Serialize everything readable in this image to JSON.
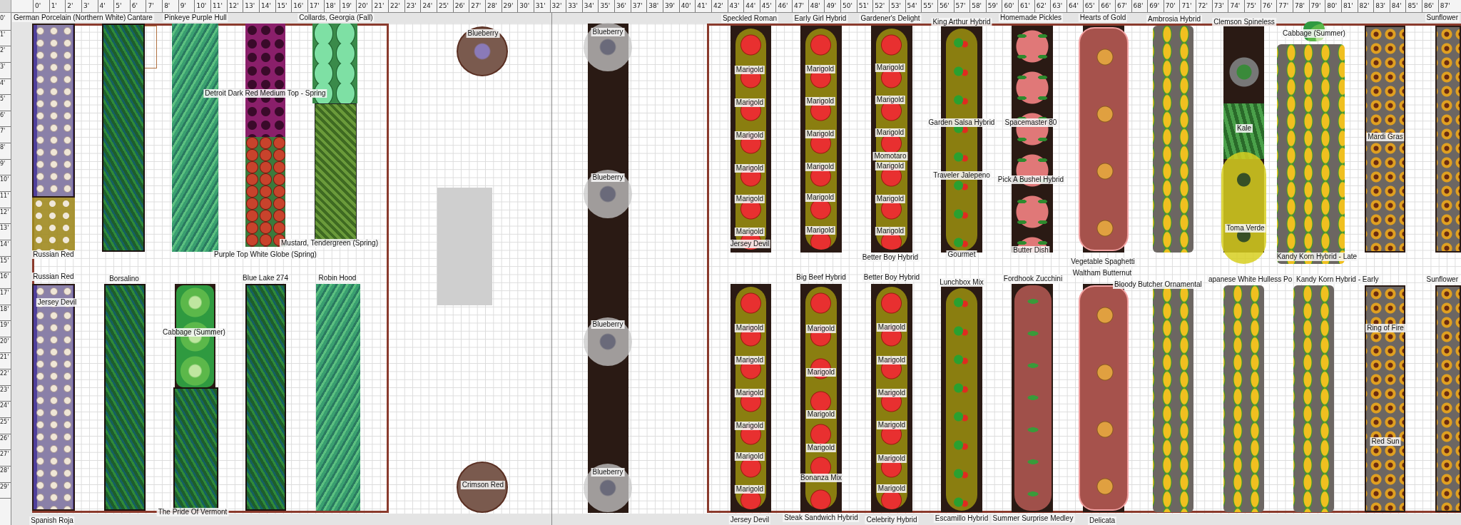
{
  "ruler": {
    "x": [
      "0'",
      "1'",
      "2'",
      "3'",
      "4'",
      "5'",
      "6'",
      "7'",
      "8'",
      "9'",
      "10'",
      "11'",
      "12'",
      "13'",
      "14'",
      "15'",
      "16'",
      "17'",
      "18'",
      "19'",
      "20'",
      "21'",
      "22'",
      "23'",
      "24'",
      "25'",
      "26'",
      "27'",
      "28'",
      "29'",
      "30'",
      "31'",
      "32'",
      "33'",
      "34'",
      "35'",
      "36'",
      "37'",
      "38'",
      "39'",
      "40'",
      "41'",
      "42'",
      "43'",
      "44'",
      "45'",
      "46'",
      "47'",
      "48'",
      "49'",
      "50'",
      "51'",
      "52'",
      "53'",
      "54'",
      "55'",
      "56'",
      "57'",
      "58'",
      "59'",
      "60'",
      "61'",
      "62'",
      "63'",
      "64'",
      "65'",
      "66'",
      "67'",
      "68'",
      "69'",
      "70'",
      "71'",
      "72'",
      "73'",
      "74'",
      "75'",
      "76'",
      "77'",
      "78'",
      "79'",
      "80'",
      "81'",
      "82'",
      "83'",
      "84'",
      "85'",
      "86'",
      "87'"
    ],
    "y": [
      "0'",
      "1'",
      "2'",
      "3'",
      "4'",
      "5'",
      "6'",
      "7'",
      "8'",
      "9'",
      "10'",
      "11'",
      "12'",
      "13'",
      "14'",
      "15'",
      "16'",
      "17'",
      "18'",
      "19'",
      "20'",
      "21'",
      "22'",
      "23'",
      "24'",
      "25'",
      "26'",
      "27'",
      "28'",
      "29'"
    ]
  },
  "plantings": [
    {
      "kind": "garlic",
      "labels": [
        "German Porcelain (Northern White)"
      ]
    },
    {
      "kind": "softneck",
      "labels": [
        "Russian Red"
      ]
    },
    {
      "kind": "beans",
      "labels": [
        "Cantare"
      ]
    },
    {
      "kind": "peas",
      "labels": [
        "Pinkeye Purple Hull"
      ]
    },
    {
      "kind": "beets",
      "labels": [
        "Detroit Dark Red Medium Top - Spring"
      ]
    },
    {
      "kind": "turnips",
      "labels": [
        "Purple Top White Globe (Spring)"
      ]
    },
    {
      "kind": "collards",
      "labels": [
        "Collards, Georgia (Fall)"
      ]
    },
    {
      "kind": "mustard",
      "labels": [
        "Mustard, Tendergreen (Spring)"
      ]
    },
    {
      "kind": "garlic",
      "labels": [
        "Russian Red",
        "Jersey Devil",
        "Spanish Roja"
      ]
    },
    {
      "kind": "beans",
      "labels": [
        "Borsalino"
      ]
    },
    {
      "kind": "cabbage",
      "labels": [
        "Cabbage (Summer)"
      ]
    },
    {
      "kind": "beans",
      "labels": [
        "The Pride Of Vermont"
      ]
    },
    {
      "kind": "beans",
      "labels": [
        "Blue Lake 274"
      ]
    },
    {
      "kind": "peas",
      "labels": [
        "Robin Hood"
      ]
    },
    {
      "kind": "blueberry",
      "labels": [
        "Blueberry"
      ]
    },
    {
      "kind": "shrub",
      "labels": [
        "Crimson Red"
      ]
    },
    {
      "kind": "bush",
      "labels": [
        "Blueberry"
      ]
    },
    {
      "kind": "bush",
      "labels": [
        "Blueberry"
      ]
    },
    {
      "kind": "bush",
      "labels": [
        "Blueberry"
      ]
    },
    {
      "kind": "bush",
      "labels": [
        "Blueberry"
      ]
    },
    {
      "kind": "tomatoes",
      "labels": [
        "Speckled Roman",
        "Marigold",
        "Marigold",
        "Marigold",
        "Marigold",
        "Marigold",
        "Marigold",
        "Jersey Devil"
      ]
    },
    {
      "kind": "tomatoes",
      "labels": [
        "Marigold",
        "Marigold",
        "Marigold",
        "Marigold",
        "Marigold",
        "Marigold",
        "Jersey Devil"
      ]
    },
    {
      "kind": "tomatoes",
      "labels": [
        "Early Girl Hybrid",
        "Marigold",
        "Marigold",
        "Marigold",
        "Marigold",
        "Marigold",
        "Marigold"
      ]
    },
    {
      "kind": "tomatoes",
      "labels": [
        "Big Beef Hybrid",
        "Marigold",
        "Marigold",
        "Marigold",
        "Marigold",
        "Bonanza Mix",
        "Steak Sandwich Hybrid"
      ]
    },
    {
      "kind": "tomatoes",
      "labels": [
        "Gardener's Delight",
        "Marigold",
        "Marigold",
        "Marigold",
        "Momotaro",
        "Marigold",
        "Marigold",
        "Marigold",
        "Better Boy Hybrid"
      ]
    },
    {
      "kind": "tomatoes",
      "labels": [
        "Better Boy Hybrid",
        "Marigold",
        "Marigold",
        "Marigold",
        "Marigold",
        "Marigold",
        "Marigold",
        "Celebrity Hybrid"
      ]
    },
    {
      "kind": "peppers",
      "labels": [
        "King Arthur Hybrid",
        "Garden Salsa Hybrid",
        "Traveler Jalepeno",
        "Gourmet"
      ]
    },
    {
      "kind": "peppers",
      "labels": [
        "Lunchbox Mix",
        "Escamillo Hybrid"
      ]
    },
    {
      "kind": "cucumbers",
      "labels": [
        "Homemade Pickles",
        "Spacemaster 80",
        "Pick A Bushel Hybrid",
        "Butter Dish"
      ]
    },
    {
      "kind": "zucchini",
      "labels": [
        "Fordhook Zucchini",
        "Summer Surprise Medley"
      ]
    },
    {
      "kind": "squash",
      "labels": [
        "Hearts of Gold",
        "Vegetable Spaghetti"
      ]
    },
    {
      "kind": "squash",
      "labels": [
        "Waltham Butternut",
        "Delicata"
      ]
    },
    {
      "kind": "corn",
      "labels": [
        "Ambrosia Hybrid"
      ]
    },
    {
      "kind": "corn",
      "labels": [
        "Bloody Butcher Ornamental"
      ]
    },
    {
      "kind": "okra",
      "labels": [
        "Clemson Spineless"
      ]
    },
    {
      "kind": "kale",
      "labels": [
        "Kale"
      ]
    },
    {
      "kind": "tomatillo",
      "labels": [
        "Toma Verde"
      ]
    },
    {
      "kind": "cabbage",
      "labels": [
        "Cabbage (Summer)"
      ]
    },
    {
      "kind": "corn",
      "labels": [
        "Kandy Korn Hybrid - Late"
      ]
    },
    {
      "kind": "corn",
      "labels": [
        "apanese White Hulless Po"
      ]
    },
    {
      "kind": "corn",
      "labels": [
        "Kandy Korn Hybrid - Early"
      ]
    },
    {
      "kind": "sunflowers",
      "labels": [
        "Mardi Gras"
      ]
    },
    {
      "kind": "sunflowers",
      "labels": [
        "Ring of Fire",
        "Red Sun"
      ]
    },
    {
      "kind": "sunflowers",
      "labels": [
        "Sunflower"
      ]
    },
    {
      "kind": "sunflowers",
      "labels": [
        "Sunflower"
      ]
    }
  ]
}
